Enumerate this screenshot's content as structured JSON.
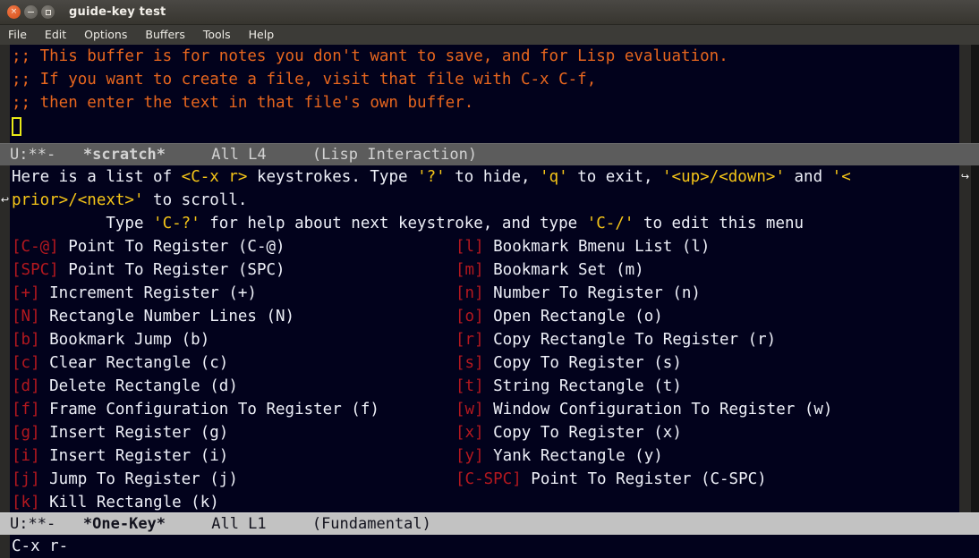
{
  "window": {
    "title": "guide-key test",
    "buttons": [
      {
        "name": "close",
        "glyph": "×"
      },
      {
        "name": "minimize",
        "glyph": "–"
      },
      {
        "name": "maximize",
        "glyph": "□"
      }
    ]
  },
  "menubar": {
    "items": [
      "File",
      "Edit",
      "Options",
      "Buffers",
      "Tools",
      "Help"
    ]
  },
  "scratch": {
    "lines": [
      ";; This buffer is for notes you don't want to save, and for Lisp evaluation.",
      ";; If you want to create a file, visit that file with C-x C-f,",
      ";; then enter the text in that file's own buffer."
    ],
    "modeline": {
      "flags": "U:**-",
      "buffer": "*scratch*",
      "position": "All L4",
      "mode": "(Lisp Interaction)"
    }
  },
  "onekey": {
    "header": {
      "l1_a": "Here is a list of ",
      "l1_key": "<C-x r>",
      "l1_b": " keystrokes. Type ",
      "l1_q1": "'?'",
      "l1_c": " to hide, ",
      "l1_q2": "'q'",
      "l1_d": " to exit, ",
      "l1_q3": "'<up>/<down>'",
      "l1_e": " and ",
      "l1_q4": "'<",
      "l2_q": "prior>/<next>'",
      "l2_rest": " to scroll.",
      "l3_pad": "          Type ",
      "l3_q1": "'C-?'",
      "l3_mid": " for help about next keystroke, and type ",
      "l3_q2": "'C-/'",
      "l3_end": " to edit this menu"
    },
    "bindings_left": [
      {
        "key": "[C-@]",
        "desc": " Point To Register (C-@)"
      },
      {
        "key": "[SPC]",
        "desc": " Point To Register (SPC)"
      },
      {
        "key": "[+]",
        "desc": " Increment Register (+)"
      },
      {
        "key": "[N]",
        "desc": " Rectangle Number Lines (N)"
      },
      {
        "key": "[b]",
        "desc": " Bookmark Jump (b)"
      },
      {
        "key": "[c]",
        "desc": " Clear Rectangle (c)"
      },
      {
        "key": "[d]",
        "desc": " Delete Rectangle (d)"
      },
      {
        "key": "[f]",
        "desc": " Frame Configuration To Register (f)"
      },
      {
        "key": "[g]",
        "desc": " Insert Register (g)"
      },
      {
        "key": "[i]",
        "desc": " Insert Register (i)"
      },
      {
        "key": "[j]",
        "desc": " Jump To Register (j)"
      },
      {
        "key": "[k]",
        "desc": " Kill Rectangle (k)"
      }
    ],
    "bindings_right": [
      {
        "key": "[l]",
        "desc": " Bookmark Bmenu List (l)"
      },
      {
        "key": "[m]",
        "desc": " Bookmark Set (m)"
      },
      {
        "key": "[n]",
        "desc": " Number To Register (n)"
      },
      {
        "key": "[o]",
        "desc": " Open Rectangle (o)"
      },
      {
        "key": "[r]",
        "desc": " Copy Rectangle To Register (r)"
      },
      {
        "key": "[s]",
        "desc": " Copy To Register (s)"
      },
      {
        "key": "[t]",
        "desc": " String Rectangle (t)"
      },
      {
        "key": "[w]",
        "desc": " Window Configuration To Register (w)"
      },
      {
        "key": "[x]",
        "desc": " Copy To Register (x)"
      },
      {
        "key": "[y]",
        "desc": " Yank Rectangle (y)"
      },
      {
        "key": "[C-SPC]",
        "desc": " Point To Register (C-SPC)"
      },
      {
        "key": "",
        "desc": ""
      }
    ],
    "modeline": {
      "flags": "U:**-",
      "buffer": "*One-Key*",
      "position": "All L1",
      "mode": "(Fundamental)"
    }
  },
  "minibuffer": {
    "text": "C-x r-"
  },
  "glyphs": {
    "wrap_arrow": "↩",
    "continuation_arrow": "↪"
  },
  "colors": {
    "background": "#02021c",
    "comment": "#e8661e",
    "key": "#b4181f",
    "highlight": "#f5c518",
    "text": "#eef0f8",
    "modeline_inactive_bg": "#5c5c5c",
    "modeline_active_bg": "#c2c2c2",
    "fringe": "#2b2a28",
    "cursor": "#e8e817"
  }
}
